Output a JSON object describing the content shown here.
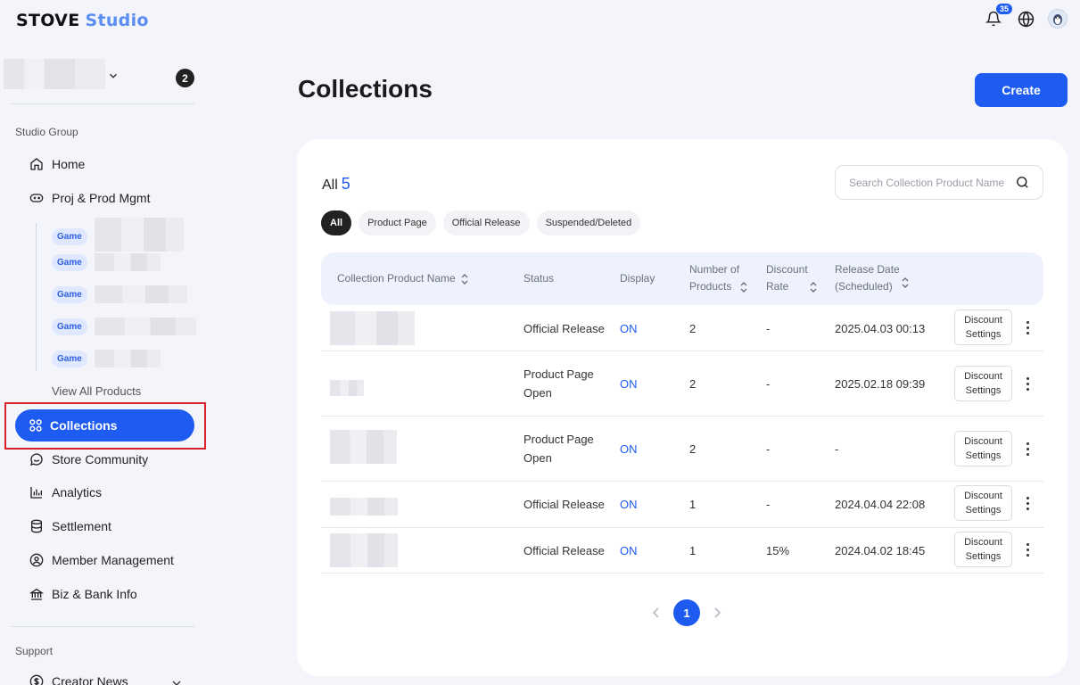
{
  "header": {
    "logo_primary": "STOVE",
    "logo_secondary": "Studio",
    "notification_count": "35"
  },
  "sidebar": {
    "studio_count": "2",
    "section_studio": "Studio Group",
    "home": "Home",
    "proj_prod": "Proj & Prod Mgmt",
    "game_tag": "Game",
    "view_all": "View All Products",
    "collections": "Collections",
    "store_community": "Store Community",
    "analytics": "Analytics",
    "settlement": "Settlement",
    "member_mgmt": "Member Management",
    "biz_bank": "Biz & Bank Info",
    "section_support": "Support",
    "creator_news": "Creator News"
  },
  "main": {
    "title": "Collections",
    "create_label": "Create",
    "all_label": "All",
    "all_count": "5",
    "search_placeholder": "Search Collection Product Name",
    "filters": [
      "All",
      "Product Page",
      "Official Release",
      "Suspended/Deleted"
    ],
    "columns": {
      "name": "Collection Product Name",
      "status": "Status",
      "display": "Display",
      "num_products_1": "Number of",
      "num_products_2": "Products",
      "discount_1": "Discount",
      "discount_2": "Rate",
      "release_1": "Release Date",
      "release_2": "(Scheduled)"
    },
    "discount_btn_1": "Discount",
    "discount_btn_2": "Settings",
    "rows": [
      {
        "status_1": "Official Release",
        "status_2": "",
        "display": "ON",
        "count": "2",
        "discount": "-",
        "release": "2025.04.03 00:13"
      },
      {
        "status_1": "Product Page",
        "status_2": "Open",
        "display": "ON",
        "count": "2",
        "discount": "-",
        "release": "2025.02.18 09:39"
      },
      {
        "status_1": "Product Page",
        "status_2": "Open",
        "display": "ON",
        "count": "2",
        "discount": "-",
        "release": "-"
      },
      {
        "status_1": "Official Release",
        "status_2": "",
        "display": "ON",
        "count": "1",
        "discount": "-",
        "release": "2024.04.04 22:08"
      },
      {
        "status_1": "Official Release",
        "status_2": "",
        "display": "ON",
        "count": "1",
        "discount": "15%",
        "release": "2024.04.02 18:45"
      }
    ],
    "current_page": "1"
  },
  "colors": {
    "accent": "#1e5bf0",
    "highlight_border": "#d6202a"
  }
}
